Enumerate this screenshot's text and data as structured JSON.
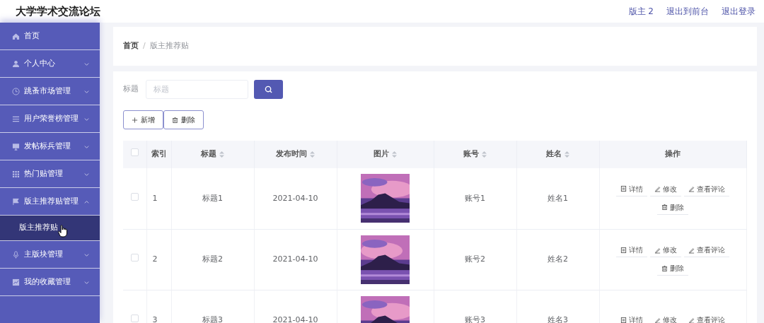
{
  "header": {
    "title": "大学学术交流论坛",
    "links": [
      "版主 2",
      "退出到前台",
      "退出登录"
    ]
  },
  "sidebar": {
    "items": [
      {
        "label": "首页"
      },
      {
        "label": "个人中心",
        "expanded": false
      },
      {
        "label": "跳蚤市场管理",
        "expanded": false
      },
      {
        "label": "用户荣誉榜管理",
        "expanded": false
      },
      {
        "label": "发帖标兵管理",
        "expanded": false
      },
      {
        "label": "热门贴管理",
        "expanded": false
      },
      {
        "label": "版主推荐贴管理",
        "expanded": true,
        "children": [
          {
            "label": "版主推荐贴",
            "selected": true
          }
        ]
      },
      {
        "label": "主版块管理",
        "expanded": false
      },
      {
        "label": "我的收藏管理",
        "expanded": false
      }
    ]
  },
  "breadcrumb": {
    "separator": "/",
    "items": [
      "首页",
      "版主推荐贴"
    ]
  },
  "search": {
    "label": "标题",
    "placeholder": "标题"
  },
  "toolbar": [
    {
      "kind": "add",
      "label": "新增"
    },
    {
      "kind": "delete",
      "label": "删除"
    }
  ],
  "table": {
    "select_all": {
      "checked": false
    },
    "columns": [
      {
        "label": "索引",
        "sortable": false
      },
      {
        "label": "标题",
        "sortable": true
      },
      {
        "label": "发布时间",
        "sortable": true
      },
      {
        "label": "图片",
        "sortable": true
      },
      {
        "label": "账号",
        "sortable": true
      },
      {
        "label": "姓名",
        "sortable": true
      },
      {
        "label": "操作",
        "sortable": false
      }
    ],
    "rows": [
      {
        "checked": false,
        "cells": [
          "1",
          "标题1",
          "2021-04-10",
          "",
          "账号1",
          "姓名1"
        ],
        "image": {
          "kind": "picture"
        },
        "actions": [
          {
            "kind": "detail",
            "label": "详情"
          },
          {
            "kind": "edit",
            "label": "修改"
          },
          {
            "kind": "edit",
            "label": "查看评论"
          },
          {
            "kind": "delete",
            "label": "删除"
          }
        ]
      },
      {
        "checked": false,
        "cells": [
          "2",
          "标题2",
          "2021-04-10",
          "",
          "账号2",
          "姓名2"
        ],
        "image": {
          "kind": "picture"
        },
        "actions": [
          {
            "kind": "detail",
            "label": "详情"
          },
          {
            "kind": "edit",
            "label": "修改"
          },
          {
            "kind": "edit",
            "label": "查看评论"
          },
          {
            "kind": "delete",
            "label": "删除"
          }
        ]
      },
      {
        "checked": false,
        "cells": [
          "3",
          "标题3",
          "2021-04-10",
          "",
          "账号3",
          "姓名3"
        ],
        "image": {
          "kind": "picture"
        },
        "actions": [
          {
            "kind": "detail",
            "label": "详情"
          },
          {
            "kind": "edit",
            "label": "修改"
          },
          {
            "kind": "edit",
            "label": "查看评论"
          }
        ]
      }
    ]
  }
}
